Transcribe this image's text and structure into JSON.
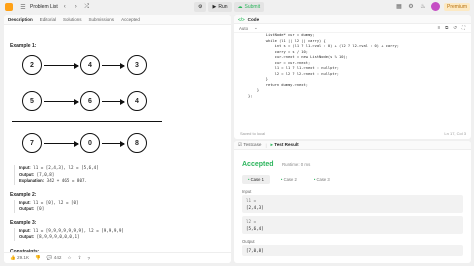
{
  "topbar": {
    "problem_list": "Problem List",
    "run": "Run",
    "submit": "Submit",
    "premium": "Premium"
  },
  "left": {
    "tabs": [
      "Description",
      "Editorial",
      "Solutions",
      "Submissions",
      "Accepted"
    ],
    "example1_title": "Example 1:",
    "row1": [
      "2",
      "4",
      "3"
    ],
    "row2": [
      "5",
      "6",
      "4"
    ],
    "row3": [
      "7",
      "0",
      "8"
    ],
    "ex1": {
      "input_label": "Input:",
      "input": "l1 = [2,4,3], l2 = [5,6,4]",
      "output_label": "Output:",
      "output": "[7,0,8]",
      "expl_label": "Explanation:",
      "explanation": "342 + 465 = 807."
    },
    "example2_title": "Example 2:",
    "ex2": {
      "input_label": "Input:",
      "input": "l1 = [0], l2 = [0]",
      "output_label": "Output:",
      "output": "[0]"
    },
    "example3_title": "Example 3:",
    "ex3": {
      "input_label": "Input:",
      "input": "l1 = [9,9,9,9,9,9,9], l2 = [9,9,9,9]",
      "output_label": "Output:",
      "output": "[8,9,9,9,0,0,0,1]"
    },
    "constraints": "Constraints:",
    "bottom": {
      "likes": "29.1K",
      "comments": "442"
    }
  },
  "code": {
    "title": "Code",
    "lang": "Auto",
    "lines": [
      {
        "n": "",
        "t": "        ListNode* cur = dummy;"
      },
      {
        "n": "",
        "t": "        while (l1 || l2 || carry) {"
      },
      {
        "n": "",
        "t": "            int s = (l1 ? l1->val : 0) + (l2 ? l2->val : 0) + carry;"
      },
      {
        "n": "",
        "t": "            carry = s / 10;"
      },
      {
        "n": "",
        "t": "            cur->next = new ListNode(s % 10);"
      },
      {
        "n": "",
        "t": "            cur = cur->next;"
      },
      {
        "n": "",
        "t": "            l1 = l1 ? l1->next : nullptr;"
      },
      {
        "n": "",
        "t": "            l2 = l2 ? l2->next : nullptr;"
      },
      {
        "n": "",
        "t": "        }"
      },
      {
        "n": "",
        "t": "        return dummy->next;"
      },
      {
        "n": "",
        "t": "    }"
      },
      {
        "n": "",
        "t": "};"
      }
    ],
    "saved": "Saved to local",
    "position": "Ln 17, Col 3"
  },
  "result": {
    "tab_testcase": "Testcase",
    "tab_result": "Test Result",
    "status": "Accepted",
    "runtime": "Runtime: 0 ms",
    "cases": [
      "Case 1",
      "Case 2",
      "Case 3"
    ],
    "input_label": "Input",
    "l1_label": "l1 =",
    "l1_value": "[2,4,3]",
    "l2_label": "l2 =",
    "l2_value": "[5,6,4]",
    "output_label": "Output",
    "output_value": "[7,0,8]"
  }
}
